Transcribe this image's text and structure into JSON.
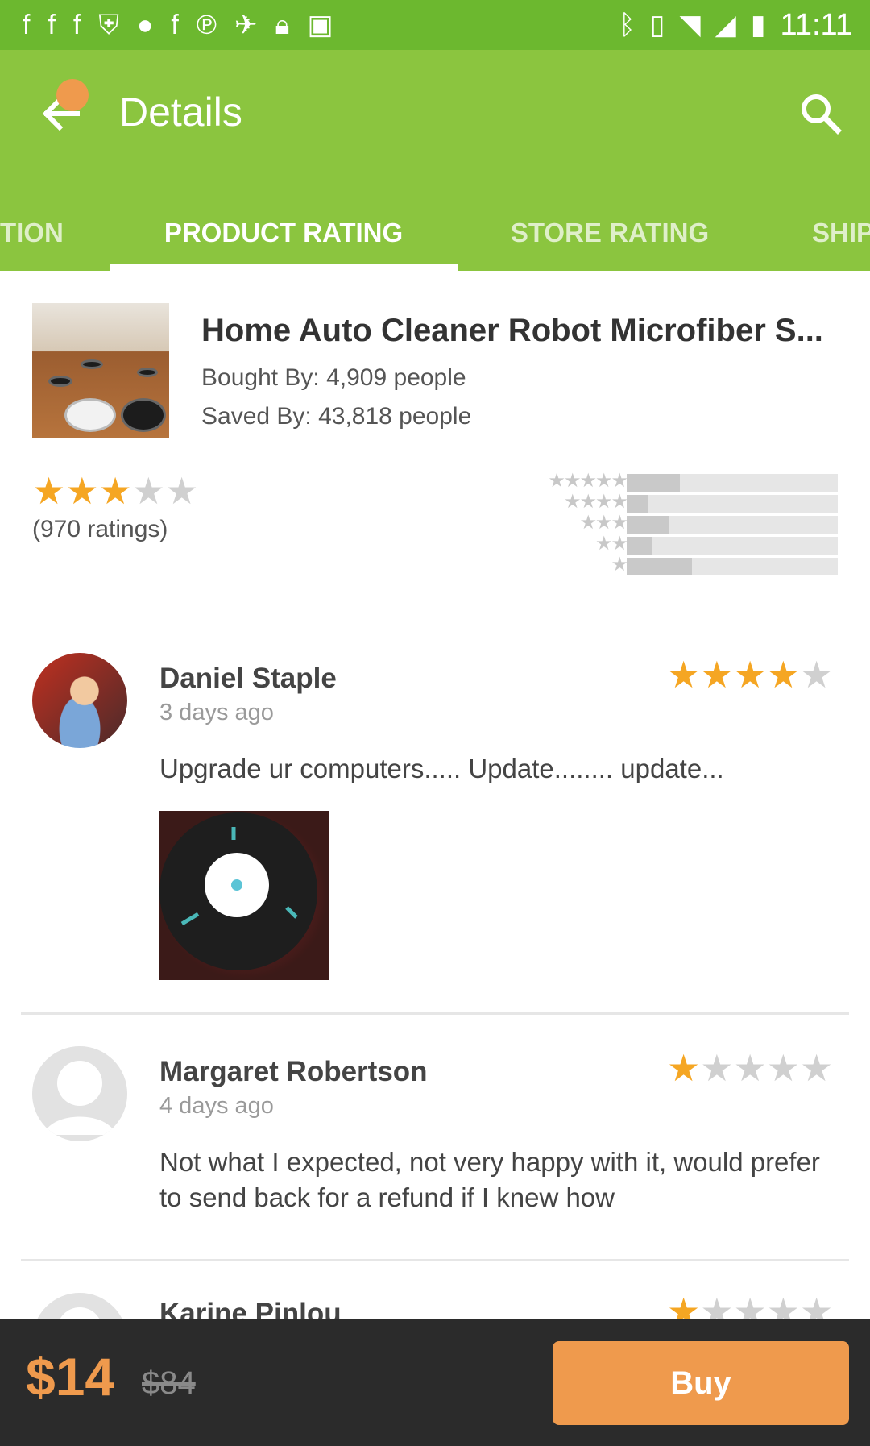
{
  "status_bar": {
    "icons": [
      "facebook-icon",
      "facebook-icon",
      "facebook-icon",
      "shield-icon",
      "circle-icon",
      "facebook-icon",
      "pinterest-icon",
      "satellite-icon",
      "lock-icon",
      "android-icon",
      "bluetooth-icon",
      "vibrate-icon",
      "wifi-icon",
      "signal-icon",
      "battery-icon"
    ],
    "time": "11:11"
  },
  "app_bar": {
    "title": "Details",
    "colors": {
      "primary": "#8bc53f",
      "status": "#6cb82f",
      "accent": "#ef9a4d"
    }
  },
  "tabs": [
    {
      "label": "TION",
      "active": false
    },
    {
      "label": "PRODUCT RATING",
      "active": true
    },
    {
      "label": "STORE RATING",
      "active": false
    },
    {
      "label": "SHIP",
      "active": false
    }
  ],
  "product": {
    "name": "Home Auto Cleaner Robot Microfiber S...",
    "bought_by": "Bought By: 4,909 people",
    "saved_by": "Saved By: 43,818 people",
    "rating_stars": 3,
    "ratings_count": "(970 ratings)",
    "distribution": [
      {
        "stars": 5,
        "fraction": 0.25
      },
      {
        "stars": 4,
        "fraction": 0.1
      },
      {
        "stars": 3,
        "fraction": 0.2
      },
      {
        "stars": 2,
        "fraction": 0.12
      },
      {
        "stars": 1,
        "fraction": 0.31
      }
    ]
  },
  "reviews": [
    {
      "name": "Daniel Staple",
      "date": "3 days ago",
      "stars": 4,
      "text": "Upgrade ur computers..... Update........ update...",
      "has_photo": true
    },
    {
      "name": "Margaret Robertson",
      "date": "4 days ago",
      "stars": 1,
      "text": "Not what I expected, not very happy with it, would prefer to send back for a refund if I knew how",
      "has_photo": false
    },
    {
      "name": "Karine Pinlou",
      "date": "",
      "stars": 1,
      "text": "",
      "has_photo": false
    }
  ],
  "bottom_bar": {
    "price": "$14",
    "old_price": "$84",
    "buy_label": "Buy"
  }
}
